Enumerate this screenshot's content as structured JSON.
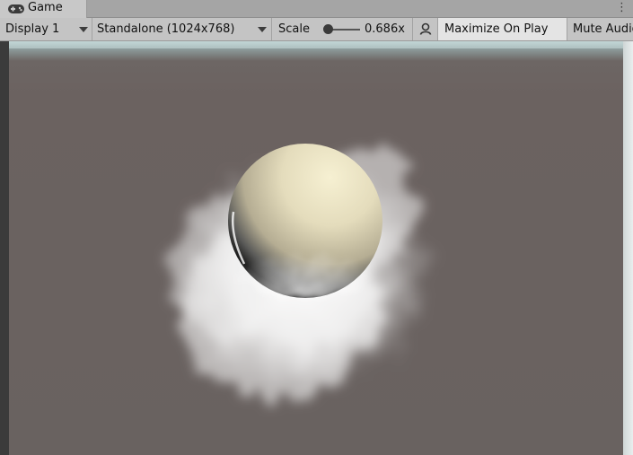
{
  "tab": {
    "label": "Game",
    "icon": "gamepad-icon"
  },
  "menu": {
    "icon": "more-vert-icon",
    "glyph": "⋮"
  },
  "toolbar": {
    "display": "Display 1",
    "resolution": "Standalone (1024x768)",
    "scale_label": "Scale",
    "scale_value": "0.686x",
    "user_icon": "user-icon",
    "maximize": "Maximize On Play",
    "mute": "Mute Audio"
  },
  "colors": {
    "sky": "#b9cfcf",
    "ground": "#6b6260",
    "sphere": "#e6e0c4",
    "cloud": "#f4f4f4"
  }
}
